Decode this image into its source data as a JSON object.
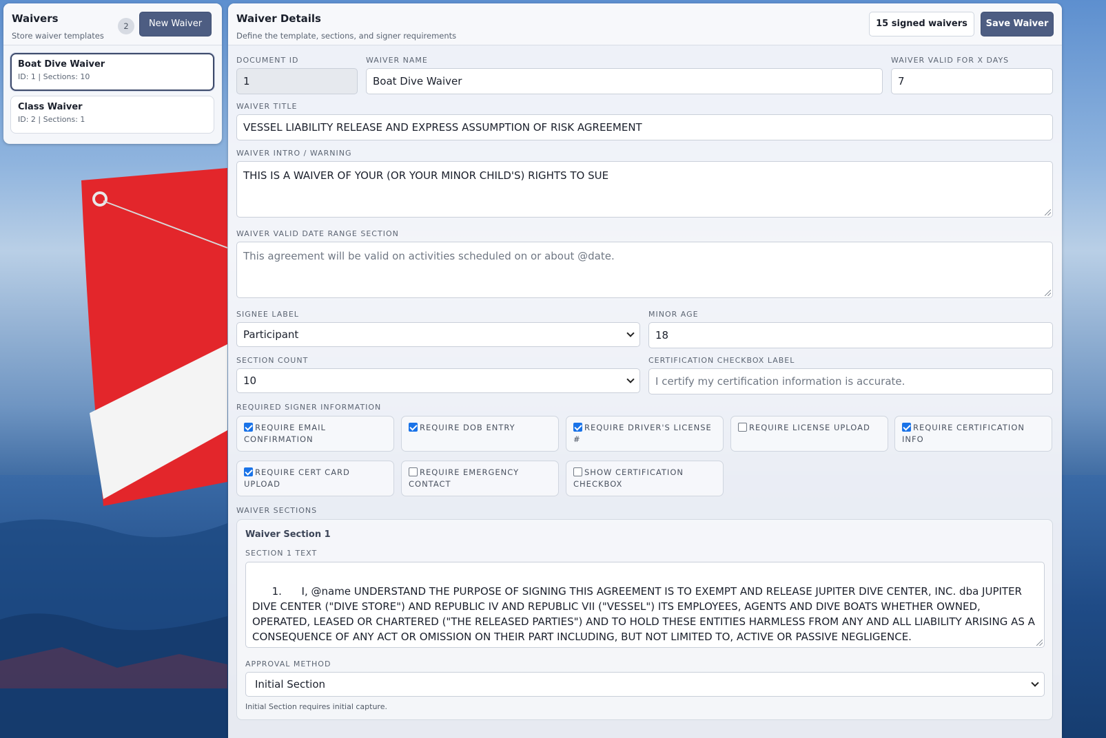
{
  "sidebar": {
    "title": "Waivers",
    "subtitle": "Store waiver templates",
    "count": "2",
    "new_button": "New Waiver",
    "items": [
      {
        "name": "Boat Dive Waiver",
        "meta": "ID: 1 | Sections: 10",
        "active": true
      },
      {
        "name": "Class Waiver",
        "meta": "ID: 2 | Sections: 1",
        "active": false
      }
    ]
  },
  "details": {
    "title": "Waiver Details",
    "subtitle": "Define the template, sections, and signer requirements",
    "signed_button": "15 signed waivers",
    "save_button": "Save Waiver"
  },
  "form": {
    "document_id": {
      "label": "DOCUMENT ID",
      "value": "1"
    },
    "waiver_name": {
      "label": "WAIVER NAME",
      "value": "Boat Dive Waiver"
    },
    "valid_days": {
      "label": "WAIVER VALID FOR X DAYS",
      "value": "7"
    },
    "waiver_title": {
      "label": "WAIVER TITLE",
      "value": "VESSEL LIABILITY RELEASE AND EXPRESS ASSUMPTION OF RISK AGREEMENT"
    },
    "intro": {
      "label": "WAIVER INTRO / WARNING",
      "value": "THIS IS A WAIVER OF YOUR (OR YOUR MINOR CHILD'S) RIGHTS TO SUE"
    },
    "date_range": {
      "label": "WAIVER VALID DATE RANGE SECTION",
      "placeholder": "This agreement will be valid on activities scheduled on or about @date."
    },
    "signee_label": {
      "label": "SIGNEE LABEL",
      "value": "Participant"
    },
    "minor_age": {
      "label": "MINOR AGE",
      "value": "18"
    },
    "section_count": {
      "label": "SECTION COUNT",
      "value": "10"
    },
    "cert_checkbox_label": {
      "label": "CERTIFICATION CHECKBOX LABEL",
      "placeholder": "I certify my certification information is accurate."
    },
    "required_info_label": "REQUIRED SIGNER INFORMATION",
    "requirements": [
      {
        "label": "REQUIRE EMAIL CONFIRMATION",
        "checked": true
      },
      {
        "label": "REQUIRE DOB ENTRY",
        "checked": true
      },
      {
        "label": "REQUIRE DRIVER'S LICENSE #",
        "checked": true
      },
      {
        "label": "REQUIRE LICENSE UPLOAD",
        "checked": false
      },
      {
        "label": "REQUIRE CERTIFICATION INFO",
        "checked": true
      },
      {
        "label": "REQUIRE CERT CARD UPLOAD",
        "checked": true
      },
      {
        "label": "REQUIRE EMERGENCY CONTACT",
        "checked": false
      },
      {
        "label": "SHOW CERTIFICATION CHECKBOX",
        "checked": false
      }
    ],
    "sections_label": "WAIVER SECTIONS"
  },
  "section1": {
    "title": "Waiver Section 1",
    "text_label": "SECTION 1 TEXT",
    "text": "1.      I, @name UNDERSTAND THE PURPOSE OF SIGNING THIS AGREEMENT IS TO EXEMPT AND RELEASE JUPITER DIVE CENTER, INC. dba JUPITER DIVE CENTER (\"DIVE STORE\") AND REPUBLIC IV AND REPUBLIC VII (\"VESSEL\") ITS EMPLOYEES, AGENTS AND DIVE BOATS WHETHER OWNED, OPERATED, LEASED OR CHARTERED (\"THE RELEASED PARTIES\") AND TO HOLD THESE ENTITIES HARMLESS FROM ANY AND ALL LIABILITY ARISING AS A CONSEQUENCE OF ANY ACT OR OMISSION ON THEIR PART INCLUDING, BUT NOT LIMITED TO, ACTIVE OR PASSIVE NEGLIGENCE.",
    "approval_label": "APPROVAL METHOD",
    "approval_value": "Initial Section",
    "approval_help": "Initial Section requires initial capture."
  },
  "colors": {
    "accent": "#4d5d82",
    "checkbox": "#1a73e8",
    "flag_red": "#e3262b"
  }
}
